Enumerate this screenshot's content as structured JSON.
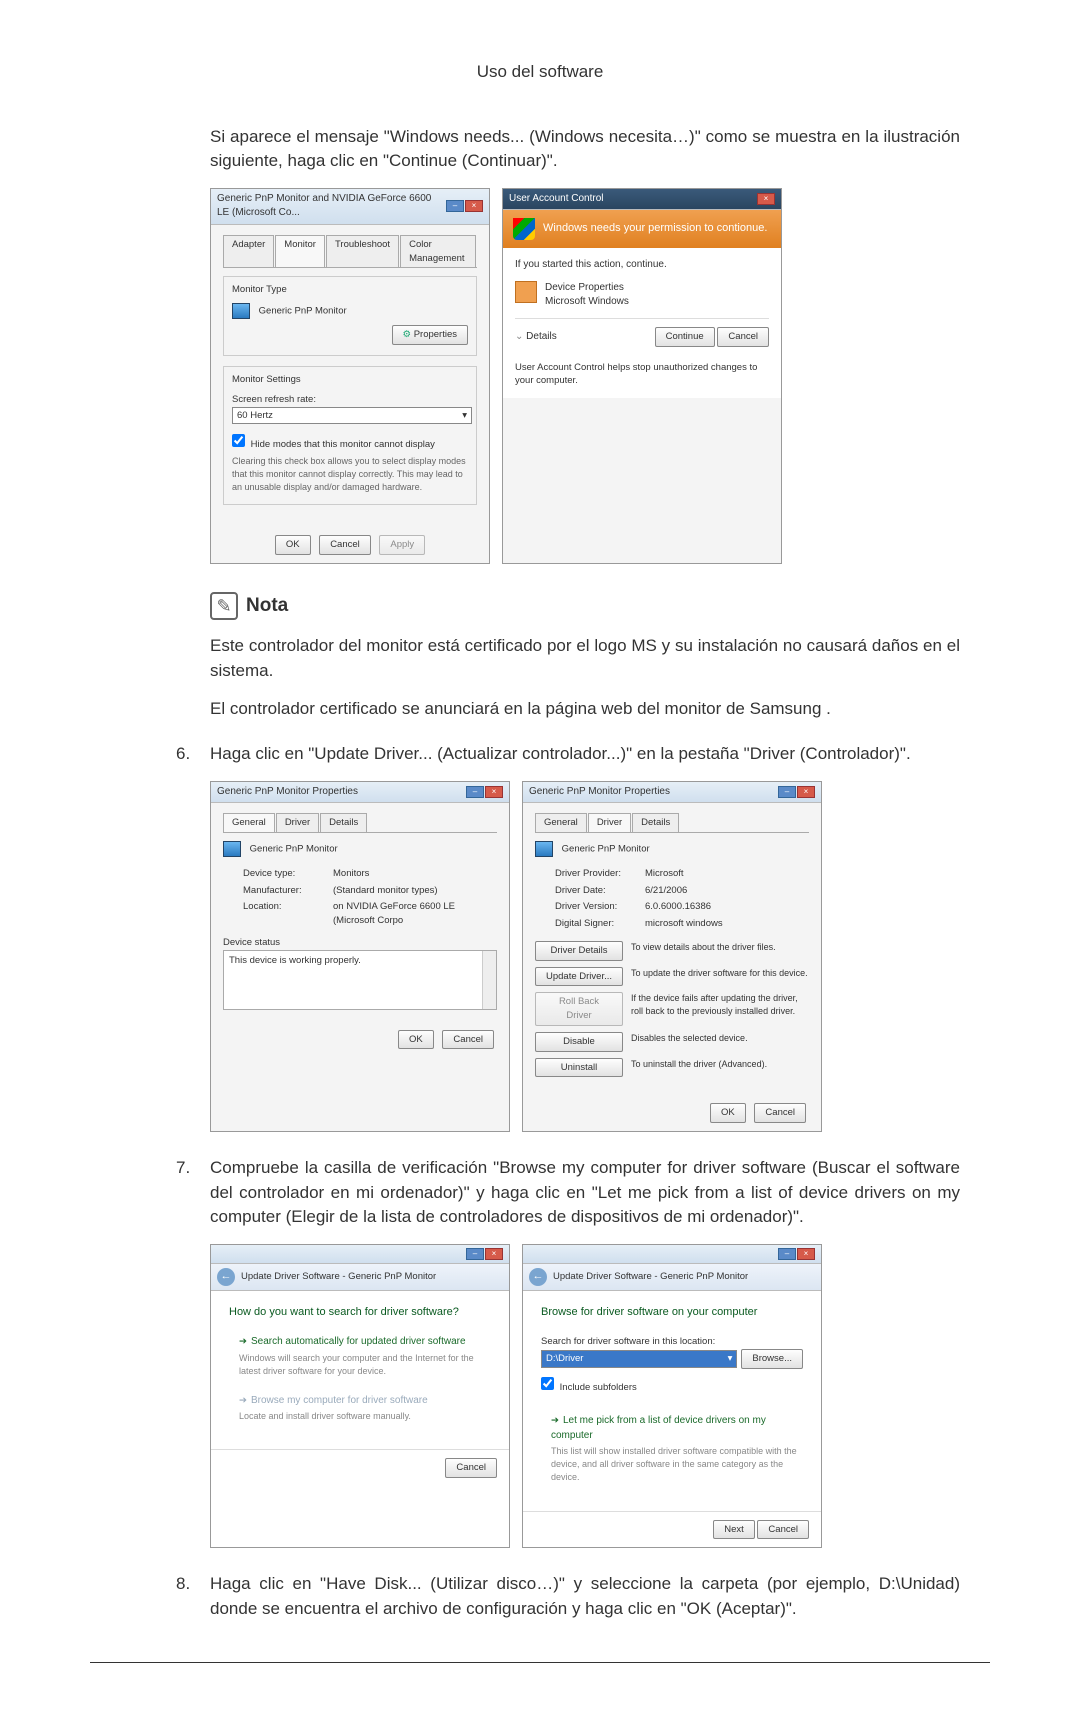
{
  "header": {
    "title": "Uso del software"
  },
  "intro_paragraph": "Si aparece el mensaje \"Windows needs... (Windows necesita…)\" como se muestra en la ilustración siguiente, haga clic en \"Continue (Continuar)\".",
  "fig1": {
    "monitor_dialog": {
      "title": "Generic PnP Monitor and NVIDIA GeForce 6600 LE (Microsoft Co...",
      "tabs": [
        "Adapter",
        "Monitor",
        "Troubleshoot",
        "Color Management"
      ],
      "active_tab": "Monitor",
      "section1_legend": "Monitor Type",
      "monitor_name": "Generic PnP Monitor",
      "properties_btn": "Properties",
      "section2_legend": "Monitor Settings",
      "refresh_label": "Screen refresh rate:",
      "refresh_value": "60 Hertz",
      "hide_checkbox": "Hide modes that this monitor cannot display",
      "hide_caption": "Clearing this check box allows you to select display modes that this monitor cannot display correctly. This may lead to an unusable display and/or damaged hardware.",
      "footer": {
        "ok": "OK",
        "cancel": "Cancel",
        "apply": "Apply"
      }
    },
    "uac": {
      "title": "User Account Control",
      "banner": "Windows needs your permission to contionue.",
      "if_started": "If you started this action, continue.",
      "prog_name": "Device Properties",
      "prog_pub": "Microsoft Windows",
      "details_label": "Details",
      "continue_btn": "Continue",
      "cancel_btn": "Cancel",
      "footer_text": "User Account Control helps stop unauthorized changes to your computer."
    }
  },
  "note": {
    "label": "Nota"
  },
  "note_p1": "Este controlador del monitor está certificado por el logo MS y su instalación no causará daños en el sistema.",
  "note_p2": "El controlador certificado se anunciará en la página web del monitor de Samsung .",
  "step6": {
    "num": "6.",
    "text": "Haga clic en \"Update Driver... (Actualizar controlador...)\" en la pestaña \"Driver (Controlador)\"."
  },
  "fig2": {
    "props_general": {
      "title": "Generic PnP Monitor Properties",
      "tabs": [
        "General",
        "Driver",
        "Details"
      ],
      "active_tab": "General",
      "monitor_name": "Generic PnP Monitor",
      "rows": [
        {
          "label": "Device type:",
          "value": "Monitors"
        },
        {
          "label": "Manufacturer:",
          "value": "(Standard monitor types)"
        },
        {
          "label": "Location:",
          "value": "on NVIDIA GeForce 6600 LE (Microsoft Corpo"
        }
      ],
      "status_legend": "Device status",
      "status_text": "This device is working properly.",
      "footer": {
        "ok": "OK",
        "cancel": "Cancel"
      }
    },
    "props_driver": {
      "title": "Generic PnP Monitor Properties",
      "tabs": [
        "General",
        "Driver",
        "Details"
      ],
      "active_tab": "Driver",
      "monitor_name": "Generic PnP Monitor",
      "rows": [
        {
          "label": "Driver Provider:",
          "value": "Microsoft"
        },
        {
          "label": "Driver Date:",
          "value": "6/21/2006"
        },
        {
          "label": "Driver Version:",
          "value": "6.0.6000.16386"
        },
        {
          "label": "Digital Signer:",
          "value": "microsoft windows"
        }
      ],
      "buttons": [
        {
          "label": "Driver Details",
          "desc": "To view details about the driver files."
        },
        {
          "label": "Update Driver...",
          "desc": "To update the driver software for this device."
        },
        {
          "label": "Roll Back Driver",
          "desc": "If the device fails after updating the driver, roll back to the previously installed driver."
        },
        {
          "label": "Disable",
          "desc": "Disables the selected device."
        },
        {
          "label": "Uninstall",
          "desc": "To uninstall the driver (Advanced)."
        }
      ],
      "footer": {
        "ok": "OK",
        "cancel": "Cancel"
      }
    }
  },
  "step7": {
    "num": "7.",
    "text": "Compruebe la casilla de verificación \"Browse my computer for driver software (Buscar el software del controlador en mi ordenador)\" y haga clic en \"Let me pick from a list of device drivers on my computer (Elegir de la lista de controladores de dispositivos de mi ordenador)\"."
  },
  "fig3": {
    "wiz1": {
      "breadcrumb": "Update Driver Software - Generic PnP Monitor",
      "heading": "How do you want to search for driver software?",
      "opt1_title": "Search automatically for updated driver software",
      "opt1_desc": "Windows will search your computer and the Internet for the latest driver software for your device.",
      "opt2_title": "Browse my computer for driver software",
      "opt2_desc": "Locate and install driver software manually.",
      "cancel": "Cancel"
    },
    "wiz2": {
      "breadcrumb": "Update Driver Software - Generic PnP Monitor",
      "heading": "Browse for driver software on your computer",
      "search_label": "Search for driver software in this location:",
      "path_value": "D:\\Driver",
      "browse_btn": "Browse...",
      "include_sub": "Include subfolders",
      "opt_title": "Let me pick from a list of device drivers on my computer",
      "opt_desc": "This list will show installed driver software compatible with the device, and all driver software in the same category as the device.",
      "next": "Next",
      "cancel": "Cancel"
    }
  },
  "step8": {
    "num": "8.",
    "text": "Haga clic en \"Have Disk... (Utilizar disco…)\" y seleccione la carpeta (por ejemplo, D:\\Unidad) donde se encuentra el archivo de configuración y haga clic en \"OK (Aceptar)\"."
  }
}
